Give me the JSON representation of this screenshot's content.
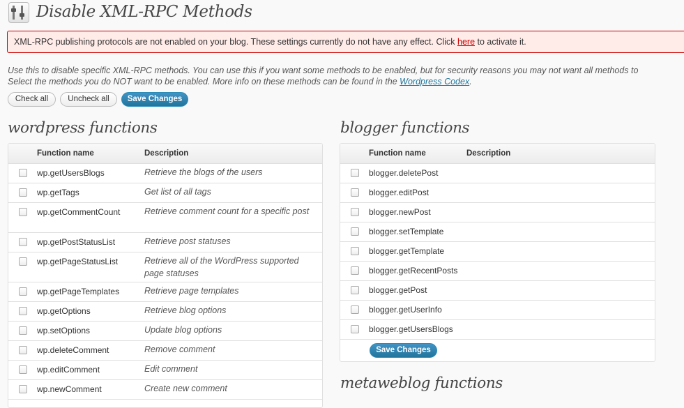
{
  "header": {
    "title": "Disable XML-RPC Methods"
  },
  "notice": {
    "text_before": "XML-RPC publishing protocols are not enabled on your blog. These settings currently do not have any effect. Click ",
    "link": "here",
    "text_after": " to activate it."
  },
  "intro": {
    "line1": "Use this to disable specific XML-RPC methods. You can use this if you want some methods to be enabled, but for security reasons you may not want all methods to",
    "line2_before": "Select the methods you do NOT want to be enabled. More info on these methods can be found in the ",
    "link": "Wordpress Codex",
    "line2_after": "."
  },
  "buttons": {
    "check_all": "Check all",
    "uncheck_all": "Uncheck all",
    "save_changes": "Save Changes"
  },
  "wordpress": {
    "title": "wordpress functions",
    "col_name": "Function name",
    "col_desc": "Description",
    "rows": [
      {
        "name": "wp.getUsersBlogs",
        "desc": "Retrieve the blogs of the users"
      },
      {
        "name": "wp.getTags",
        "desc": "Get list of all tags"
      },
      {
        "name": "wp.getCommentCount",
        "desc": "Retrieve comment count for a specific post"
      },
      {
        "name": "wp.getPostStatusList",
        "desc": "Retrieve post statuses"
      },
      {
        "name": "wp.getPageStatusList",
        "desc": "Retrieve all of the WordPress supported page statuses"
      },
      {
        "name": "wp.getPageTemplates",
        "desc": "Retrieve page templates"
      },
      {
        "name": "wp.getOptions",
        "desc": "Retrieve blog options"
      },
      {
        "name": "wp.setOptions",
        "desc": "Update blog options"
      },
      {
        "name": "wp.deleteComment",
        "desc": "Remove comment"
      },
      {
        "name": "wp.editComment",
        "desc": "Edit comment"
      },
      {
        "name": "wp.newComment",
        "desc": "Create new comment"
      }
    ]
  },
  "blogger": {
    "title": "blogger functions",
    "col_name": "Function name",
    "col_desc": "Description",
    "rows": [
      {
        "name": "blogger.deletePost",
        "desc": ""
      },
      {
        "name": "blogger.editPost",
        "desc": ""
      },
      {
        "name": "blogger.newPost",
        "desc": ""
      },
      {
        "name": "blogger.setTemplate",
        "desc": ""
      },
      {
        "name": "blogger.getTemplate",
        "desc": ""
      },
      {
        "name": "blogger.getRecentPosts",
        "desc": ""
      },
      {
        "name": "blogger.getPost",
        "desc": ""
      },
      {
        "name": "blogger.getUserInfo",
        "desc": ""
      },
      {
        "name": "blogger.getUsersBlogs",
        "desc": ""
      }
    ],
    "save_label": "Save Changes"
  },
  "metaweblog": {
    "title": "metaweblog functions"
  }
}
